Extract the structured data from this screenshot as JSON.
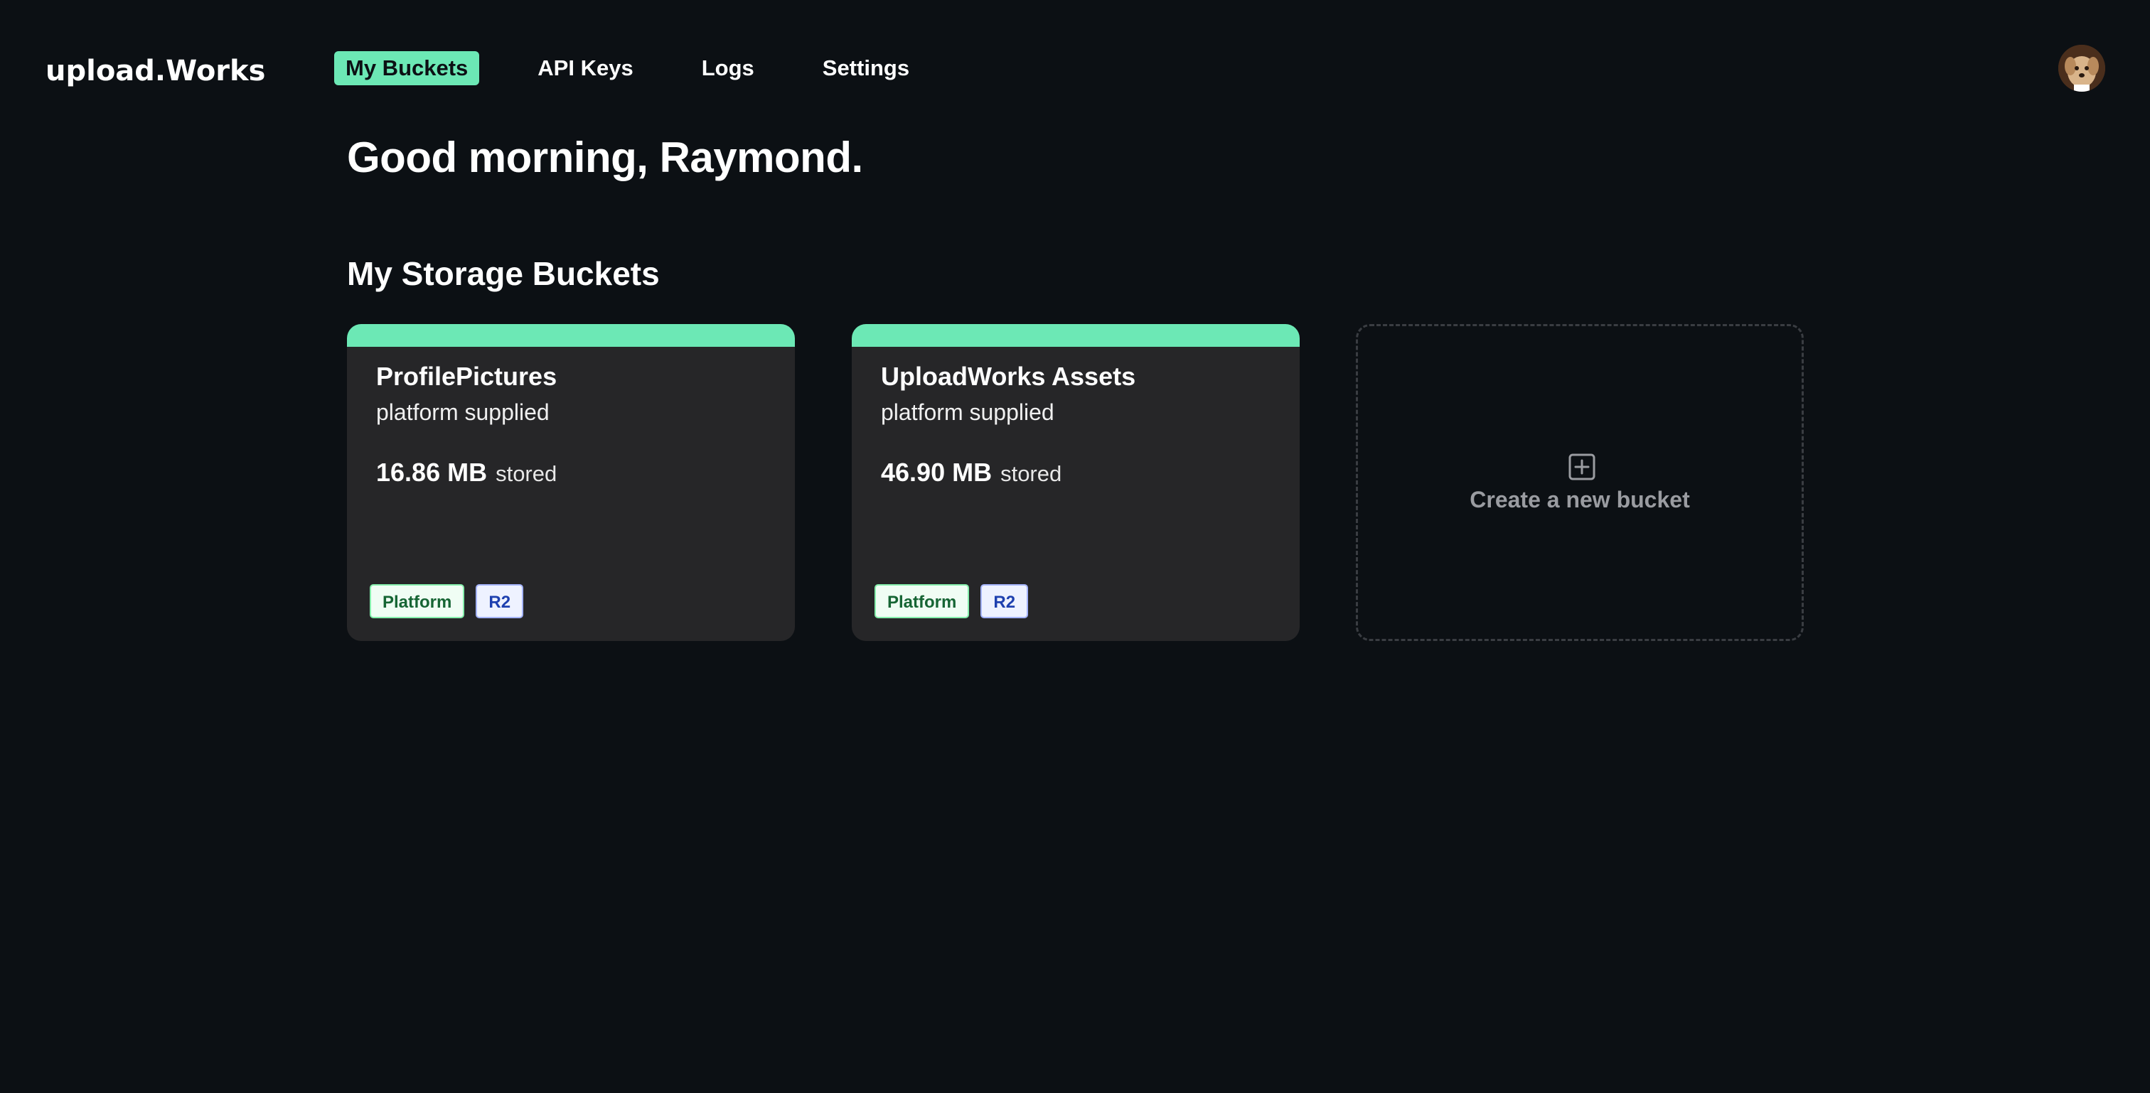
{
  "header": {
    "logo": "upload.Works",
    "nav": [
      {
        "label": "My Buckets",
        "active": true
      },
      {
        "label": "API Keys",
        "active": false
      },
      {
        "label": "Logs",
        "active": false
      },
      {
        "label": "Settings",
        "active": false
      }
    ],
    "avatar_icon": "user-avatar-dog-photo"
  },
  "main": {
    "greeting": "Good morning, Raymond.",
    "section_title": "My Storage Buckets",
    "buckets": [
      {
        "name": "ProfilePictures",
        "subtitle": "platform supplied",
        "size": "16.86 MB",
        "size_label": "stored",
        "tags": [
          "Platform",
          "R2"
        ]
      },
      {
        "name": "UploadWorks Assets",
        "subtitle": "platform supplied",
        "size": "46.90 MB",
        "size_label": "stored",
        "tags": [
          "Platform",
          "R2"
        ]
      }
    ],
    "create_bucket": {
      "label": "Create a new bucket",
      "icon": "plus-square-icon"
    }
  },
  "colors": {
    "background": "#0c1014",
    "accent": "#6ce8b5",
    "card": "#262628",
    "tag_platform_text": "#166534",
    "tag_r2_text": "#1e40af"
  }
}
